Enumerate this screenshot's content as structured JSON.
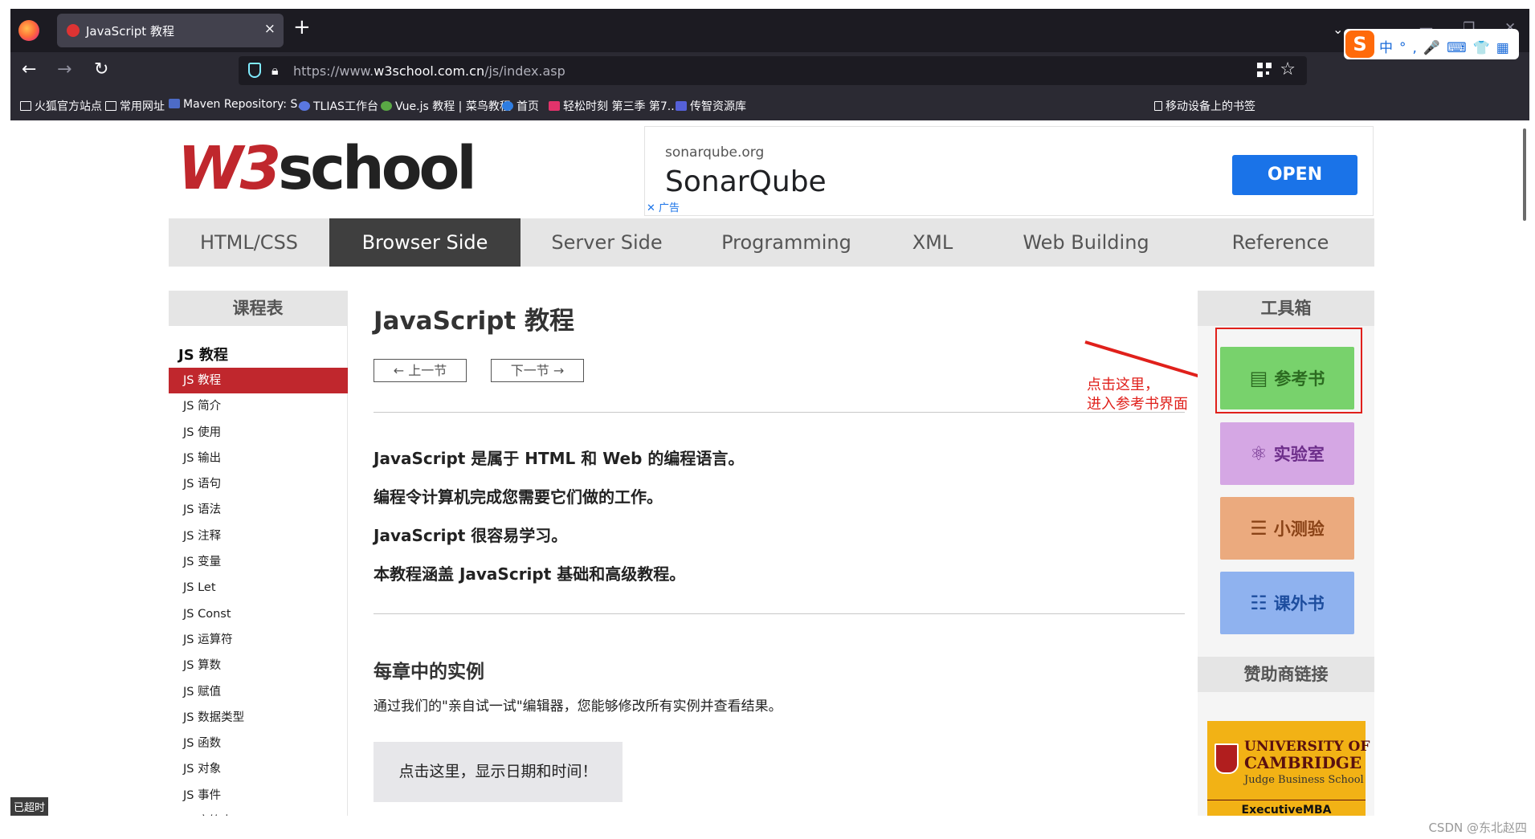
{
  "browser": {
    "tab_title": "JavaScript 教程",
    "tab_close": "×",
    "new_tab": "+",
    "tabs_list": "⌄",
    "window_controls": [
      "—",
      "❐",
      "✕"
    ],
    "url_prefix": "https://www.",
    "url_domain": "w3school.com.cn",
    "url_path": "/js/index.asp",
    "ime_items": "中°,🎤⌨👕▦",
    "ime_logo": "S",
    "bookmarks": [
      "火狐官方站点",
      "常用网址",
      "Maven Repository: S...",
      "TLIAS工作台",
      "Vue.js 教程 | 菜鸟教程",
      "首页",
      "轻松时刻 第三季 第7...",
      "传智资源库"
    ],
    "mobile_bookmarks": "移动设备上的书签"
  },
  "ad": {
    "domain": "sonarqube.org",
    "name": "SonarQube",
    "open": "OPEN",
    "label": "✕ 广告"
  },
  "logo": {
    "w3": "W3",
    "school": "school"
  },
  "topnav": [
    "HTML/CSS",
    "Browser Side",
    "Server Side",
    "Programming",
    "XML",
    "Web Building",
    "Reference"
  ],
  "leftbar": {
    "head": "课程表",
    "category": "JS 教程",
    "items": [
      "JS 教程",
      "JS 简介",
      "JS 使用",
      "JS 输出",
      "JS 语句",
      "JS 语法",
      "JS 注释",
      "JS 变量",
      "JS Let",
      "JS Const",
      "JS 运算符",
      "JS 算数",
      "JS 赋值",
      "JS 数据类型",
      "JS 函数",
      "JS 对象",
      "JS 事件",
      "JS 字符串"
    ]
  },
  "main": {
    "title": "JavaScript 教程",
    "prev": "← 上一节",
    "next": "下一节 →",
    "paragraphs": [
      "JavaScript 是属于 HTML 和 Web 的编程语言。",
      "编程令计算机完成您需要它们做的工作。",
      "JavaScript 很容易学习。",
      "本教程涵盖 JavaScript 基础和高级教程。"
    ],
    "h2": "每章中的实例",
    "desc": "通过我们的\"亲自试一试\"编辑器，您能够修改所有实例并查看结果。",
    "demo_button": "点击这里，显示日期和时间！"
  },
  "annotation": {
    "line1": "点击这里，",
    "line2": "进入参考书界面"
  },
  "toolbox": {
    "head": "工具箱",
    "reference": "参考书",
    "lab": "实验室",
    "quiz": "小测验",
    "books": "课外书",
    "sponsor": "赞助商链接"
  },
  "sponsor_ad": {
    "line1": "UNIVERSITY OF",
    "line2": "CAMBRIDGE",
    "line3": "Judge Business School",
    "line4": "ExecutiveMBA"
  },
  "status": {
    "timeout": "已超时"
  },
  "watermark": "CSDN @东北赵四",
  "colors": {
    "brand": "#c0272d",
    "nav_active": "#3f3f3f",
    "ref": "#78d26c",
    "lab": "#d5a7e4",
    "quiz": "#ebaa7e",
    "books": "#8fb2ef",
    "ad_button": "#1a73e8",
    "annotation": "#e0201b"
  }
}
